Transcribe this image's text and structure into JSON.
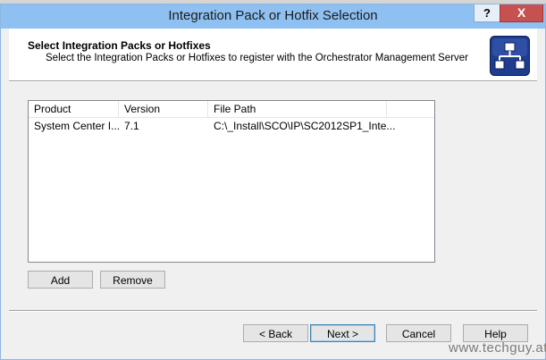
{
  "window": {
    "title": "Integration Pack or Hotfix Selection",
    "help_glyph": "?",
    "close_glyph": "X"
  },
  "header": {
    "title": "Select Integration Packs or Hotfixes",
    "subtitle": "Select the Integration Packs or Hotfixes to register with the Orchestrator Management Server",
    "icon": "network-hierarchy-icon"
  },
  "list": {
    "columns": [
      "Product",
      "Version",
      "File Path"
    ],
    "rows": [
      {
        "product": "System Center I...",
        "version": "7.1",
        "file_path": "C:\\_Install\\SCO\\IP\\SC2012SP1_Inte..."
      }
    ]
  },
  "buttons": {
    "add": "Add",
    "remove": "Remove",
    "back": "< Back",
    "next": "Next >",
    "cancel": "Cancel",
    "help": "Help"
  },
  "watermark": "www.techguy.at",
  "colors": {
    "titlebar": "#8ec1f1",
    "close": "#c75050",
    "icon_bg": "#1f3d8f"
  }
}
